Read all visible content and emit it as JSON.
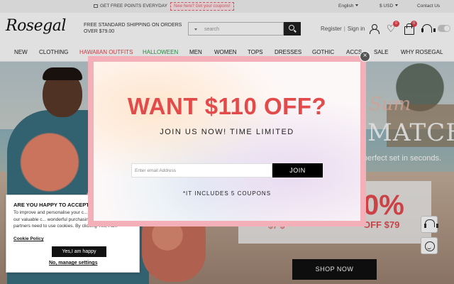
{
  "topbar": {
    "points_text": "GET FREE POINTS EVERYDAY",
    "promo_text": "New here? Get your coupons! ",
    "language": "English",
    "currency": "$ USD",
    "contact": "Contact Us"
  },
  "header": {
    "logo": "Rosegal",
    "shipping": "FREE STANDARD SHIPPING ON ORDERS OVER $79.00",
    "search_placeholder": "search",
    "register": "Register",
    "sign_in": "Sign in",
    "wishlist_count": "0",
    "cart_count": "0"
  },
  "nav": {
    "items": [
      {
        "label": "NEW",
        "color": "#222222"
      },
      {
        "label": "CLOTHING",
        "color": "#222222"
      },
      {
        "label": "HAWAIIAN OUTFITS",
        "color": "#e4444f"
      },
      {
        "label": "HALLOWEEN",
        "color": "#2c9b4b"
      },
      {
        "label": "MEN",
        "color": "#222222"
      },
      {
        "label": "WOMEN",
        "color": "#222222"
      },
      {
        "label": "TOPS",
        "color": "#222222"
      },
      {
        "label": "DRESSES",
        "color": "#222222"
      },
      {
        "label": "GOTHIC",
        "color": "#222222"
      },
      {
        "label": "ACCS",
        "color": "#222222"
      },
      {
        "label": "SALE",
        "color": "#222222"
      },
      {
        "label": "WHY ROSEGAL",
        "color": "#222222"
      }
    ]
  },
  "hero": {
    "script_text": "Sum",
    "headline": "MATCH",
    "tagline": "perfect set in seconds.",
    "discount": "0%",
    "discount_partial": "OFF $79",
    "strike_text": "$7 $",
    "shop_now": "SHOP NOW"
  },
  "modal": {
    "title": "WANT $110 OFF?",
    "subtitle": "JOIN US NOW! TIME LIMITED",
    "email_placeholder": "Enter email Address",
    "join": "JOIN",
    "note": "*IT INCLUDES 5 COUPONS",
    "close": "×"
  },
  "cookie": {
    "title": "ARE YOU HAPPY TO ACCEPT",
    "body": "To improve and personalise your c... and help us provide our valuable c... wonderful purchasing experience... partners need to use cookies. By clicking Yes, I am",
    "policy_link": "Cookie Policy",
    "accept": "Yes,I am happy",
    "decline": "No, manage settings"
  },
  "colors": {
    "accent_red": "#e34a4a",
    "modal_border": "#f4b0b8",
    "halloween_green": "#2c9b4b"
  }
}
